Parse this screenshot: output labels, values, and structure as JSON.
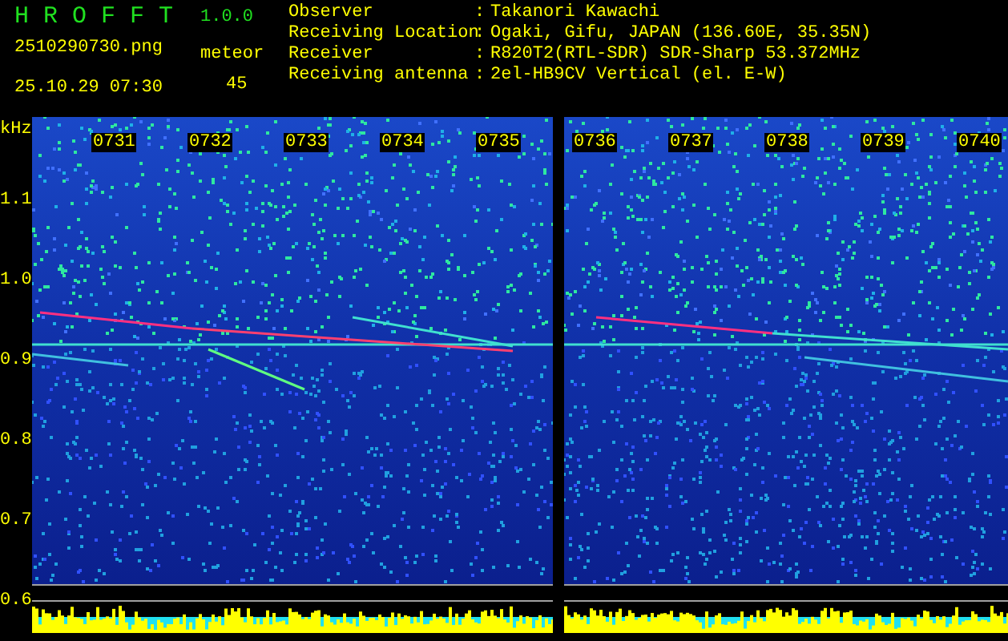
{
  "app": {
    "title": "H R O F F T",
    "version": "1.0.0",
    "file_name": "2510290730.png",
    "timestamp": "25.10.29 07:30",
    "count_label": "meteor",
    "count": "45"
  },
  "info": [
    {
      "label": "Observer",
      "separator": ":",
      "value": "Takanori Kawachi"
    },
    {
      "label": "Receiving Location",
      "separator": ":",
      "value": "Ogaki, Gifu, JAPAN (136.60E, 35.35N)"
    },
    {
      "label": "Receiver",
      "separator": ":",
      "value": "R820T2(RTL-SDR) SDR-Sharp 53.372MHz"
    },
    {
      "label": "Receiving antenna",
      "separator": ":",
      "value": "2el-HB9CV Vertical (el. E-W)"
    }
  ],
  "axis": {
    "unit": "kHz",
    "labels": [
      "1.1",
      "1.0",
      "0.9",
      "0.8",
      "0.7",
      "0.6"
    ]
  },
  "panels": [
    {
      "times": [
        "0731",
        "0732",
        "0733",
        "0734",
        "0735"
      ]
    },
    {
      "times": [
        "0736",
        "0737",
        "0738",
        "0739",
        "0740"
      ]
    }
  ]
}
